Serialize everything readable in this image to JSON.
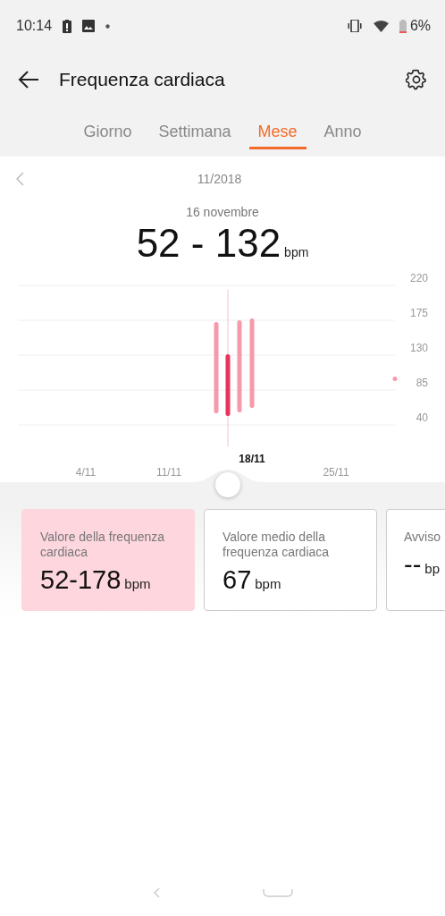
{
  "status_bar": {
    "time": "10:14",
    "battery": "6%"
  },
  "header": {
    "title": "Frequenza cardiaca"
  },
  "tabs": [
    {
      "label": "Giorno",
      "selected": false
    },
    {
      "label": "Settimana",
      "selected": false
    },
    {
      "label": "Mese",
      "selected": true
    },
    {
      "label": "Anno",
      "selected": false
    }
  ],
  "period": {
    "label": "11/2018"
  },
  "summary": {
    "date": "16 novembre",
    "value": "52 - 132",
    "unit": "bpm"
  },
  "chart": {
    "y_labels": [
      "220",
      "175",
      "130",
      "85",
      "40"
    ],
    "x_labels": [
      "4/11",
      "11/11",
      "25/11"
    ],
    "cursor_label": "18/11"
  },
  "cards": [
    {
      "label": "Valore della frequenza cardiaca",
      "value": "52-178",
      "unit": "bpm",
      "selected": true
    },
    {
      "label": "Valore medio della frequenza cardiaca",
      "value": "67",
      "unit": "bpm",
      "selected": false
    },
    {
      "label": "Avviso",
      "value": "--",
      "unit": "bp",
      "selected": false
    }
  ]
}
